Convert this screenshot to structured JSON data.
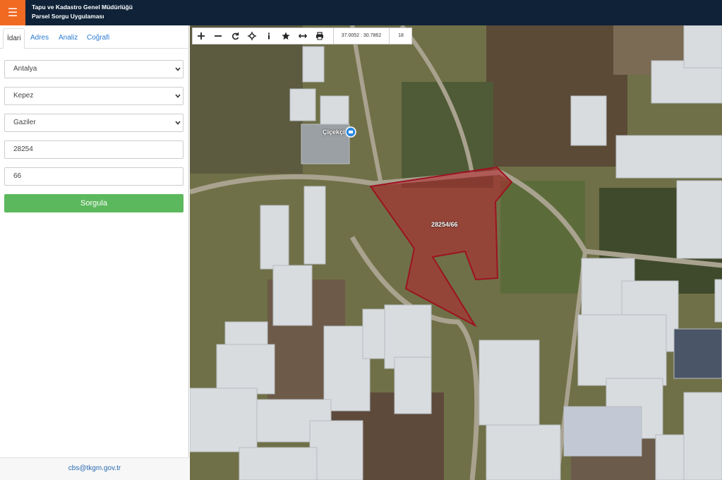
{
  "header": {
    "menu_icon": "hamburger-icon",
    "title_line1": "Tapu ve Kadastro Genel Müdürlüğü",
    "title_line2": "Parsel Sorgu Uygulaması",
    "colors": {
      "bar": "#0f2238",
      "menu": "#f06a22"
    }
  },
  "sidebar": {
    "tabs": [
      {
        "label": "İdari",
        "active": true
      },
      {
        "label": "Adres",
        "active": false
      },
      {
        "label": "Analiz",
        "active": false
      },
      {
        "label": "Coğrafi",
        "active": false
      }
    ],
    "province": "Antalya",
    "district": "Kepez",
    "neighborhood": "Gaziler",
    "block_no": "28254",
    "parcel_no": "66",
    "submit_label": "Sorgula",
    "footer_email": "cbs@tkgm.gov.tr",
    "colors": {
      "submit": "#5cb85c",
      "link": "#2a7ad1"
    }
  },
  "toolbar": {
    "icons": [
      "zoom-in-icon",
      "zoom-out-icon",
      "refresh-icon",
      "locate-icon",
      "info-icon",
      "star-icon",
      "measure-icon",
      "print-icon"
    ],
    "coordinates": "37.0052 : 30.7862",
    "zoom_level": "18"
  },
  "map": {
    "parcel_label": "28254/66",
    "poi_label": "Çiçekçi",
    "poi_icon": "shop-pin-icon",
    "colors": {
      "parcel_fill": "#b5222b",
      "parcel_stroke": "#9c1320"
    }
  }
}
